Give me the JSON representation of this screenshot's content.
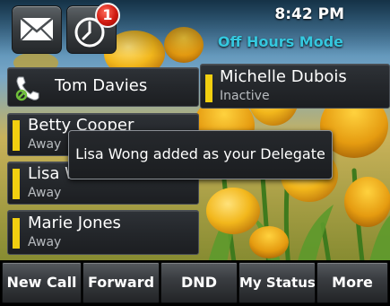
{
  "status_bar": {
    "time": "8:42 PM",
    "mode": "Off Hours Mode",
    "missed_calls_badge": "1",
    "messages_icon": "envelope-icon",
    "missed_calls_icon": "clock-icon"
  },
  "contacts": [
    {
      "name": "Tom Davies",
      "status": "",
      "icon": "phone-handset-icon"
    },
    {
      "name": "Michelle Dubois",
      "status": "Inactive",
      "status_color": "#f2cf10"
    },
    {
      "name": "Betty Cooper",
      "status": "Away",
      "status_color": "#f2cf10"
    },
    {
      "name": "Lisa W",
      "status": "Away",
      "status_color": "#f2cf10"
    },
    {
      "name": "Marie Jones",
      "status": "Away",
      "status_color": "#f2cf10"
    }
  ],
  "notification": {
    "text": "Lisa Wong added as your Delegate"
  },
  "softkeys": [
    "New Call",
    "Forward",
    "DND",
    "My Status",
    "More"
  ],
  "colors": {
    "mode_text": "#35c8df",
    "badge": "#d01a10",
    "presence_bar": "#f2cf10"
  }
}
